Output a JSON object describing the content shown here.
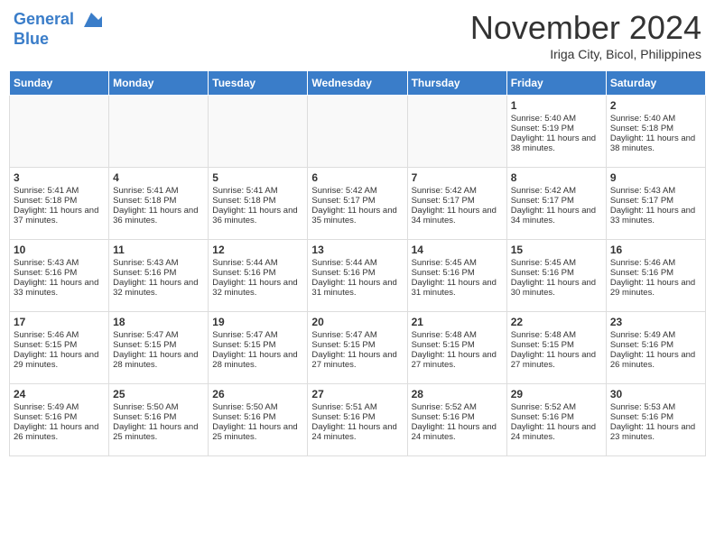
{
  "header": {
    "logo_line1": "General",
    "logo_line2": "Blue",
    "month": "November 2024",
    "location": "Iriga City, Bicol, Philippines"
  },
  "days_of_week": [
    "Sunday",
    "Monday",
    "Tuesday",
    "Wednesday",
    "Thursday",
    "Friday",
    "Saturday"
  ],
  "weeks": [
    [
      {
        "day": "",
        "empty": true
      },
      {
        "day": "",
        "empty": true
      },
      {
        "day": "",
        "empty": true
      },
      {
        "day": "",
        "empty": true
      },
      {
        "day": "",
        "empty": true
      },
      {
        "day": "1",
        "sunrise": "5:40 AM",
        "sunset": "5:19 PM",
        "daylight": "11 hours and 38 minutes."
      },
      {
        "day": "2",
        "sunrise": "5:40 AM",
        "sunset": "5:18 PM",
        "daylight": "11 hours and 38 minutes."
      }
    ],
    [
      {
        "day": "3",
        "sunrise": "5:41 AM",
        "sunset": "5:18 PM",
        "daylight": "11 hours and 37 minutes."
      },
      {
        "day": "4",
        "sunrise": "5:41 AM",
        "sunset": "5:18 PM",
        "daylight": "11 hours and 36 minutes."
      },
      {
        "day": "5",
        "sunrise": "5:41 AM",
        "sunset": "5:18 PM",
        "daylight": "11 hours and 36 minutes."
      },
      {
        "day": "6",
        "sunrise": "5:42 AM",
        "sunset": "5:17 PM",
        "daylight": "11 hours and 35 minutes."
      },
      {
        "day": "7",
        "sunrise": "5:42 AM",
        "sunset": "5:17 PM",
        "daylight": "11 hours and 34 minutes."
      },
      {
        "day": "8",
        "sunrise": "5:42 AM",
        "sunset": "5:17 PM",
        "daylight": "11 hours and 34 minutes."
      },
      {
        "day": "9",
        "sunrise": "5:43 AM",
        "sunset": "5:17 PM",
        "daylight": "11 hours and 33 minutes."
      }
    ],
    [
      {
        "day": "10",
        "sunrise": "5:43 AM",
        "sunset": "5:16 PM",
        "daylight": "11 hours and 33 minutes."
      },
      {
        "day": "11",
        "sunrise": "5:43 AM",
        "sunset": "5:16 PM",
        "daylight": "11 hours and 32 minutes."
      },
      {
        "day": "12",
        "sunrise": "5:44 AM",
        "sunset": "5:16 PM",
        "daylight": "11 hours and 32 minutes."
      },
      {
        "day": "13",
        "sunrise": "5:44 AM",
        "sunset": "5:16 PM",
        "daylight": "11 hours and 31 minutes."
      },
      {
        "day": "14",
        "sunrise": "5:45 AM",
        "sunset": "5:16 PM",
        "daylight": "11 hours and 31 minutes."
      },
      {
        "day": "15",
        "sunrise": "5:45 AM",
        "sunset": "5:16 PM",
        "daylight": "11 hours and 30 minutes."
      },
      {
        "day": "16",
        "sunrise": "5:46 AM",
        "sunset": "5:16 PM",
        "daylight": "11 hours and 29 minutes."
      }
    ],
    [
      {
        "day": "17",
        "sunrise": "5:46 AM",
        "sunset": "5:15 PM",
        "daylight": "11 hours and 29 minutes."
      },
      {
        "day": "18",
        "sunrise": "5:47 AM",
        "sunset": "5:15 PM",
        "daylight": "11 hours and 28 minutes."
      },
      {
        "day": "19",
        "sunrise": "5:47 AM",
        "sunset": "5:15 PM",
        "daylight": "11 hours and 28 minutes."
      },
      {
        "day": "20",
        "sunrise": "5:47 AM",
        "sunset": "5:15 PM",
        "daylight": "11 hours and 27 minutes."
      },
      {
        "day": "21",
        "sunrise": "5:48 AM",
        "sunset": "5:15 PM",
        "daylight": "11 hours and 27 minutes."
      },
      {
        "day": "22",
        "sunrise": "5:48 AM",
        "sunset": "5:15 PM",
        "daylight": "11 hours and 27 minutes."
      },
      {
        "day": "23",
        "sunrise": "5:49 AM",
        "sunset": "5:16 PM",
        "daylight": "11 hours and 26 minutes."
      }
    ],
    [
      {
        "day": "24",
        "sunrise": "5:49 AM",
        "sunset": "5:16 PM",
        "daylight": "11 hours and 26 minutes."
      },
      {
        "day": "25",
        "sunrise": "5:50 AM",
        "sunset": "5:16 PM",
        "daylight": "11 hours and 25 minutes."
      },
      {
        "day": "26",
        "sunrise": "5:50 AM",
        "sunset": "5:16 PM",
        "daylight": "11 hours and 25 minutes."
      },
      {
        "day": "27",
        "sunrise": "5:51 AM",
        "sunset": "5:16 PM",
        "daylight": "11 hours and 24 minutes."
      },
      {
        "day": "28",
        "sunrise": "5:52 AM",
        "sunset": "5:16 PM",
        "daylight": "11 hours and 24 minutes."
      },
      {
        "day": "29",
        "sunrise": "5:52 AM",
        "sunset": "5:16 PM",
        "daylight": "11 hours and 24 minutes."
      },
      {
        "day": "30",
        "sunrise": "5:53 AM",
        "sunset": "5:16 PM",
        "daylight": "11 hours and 23 minutes."
      }
    ]
  ]
}
